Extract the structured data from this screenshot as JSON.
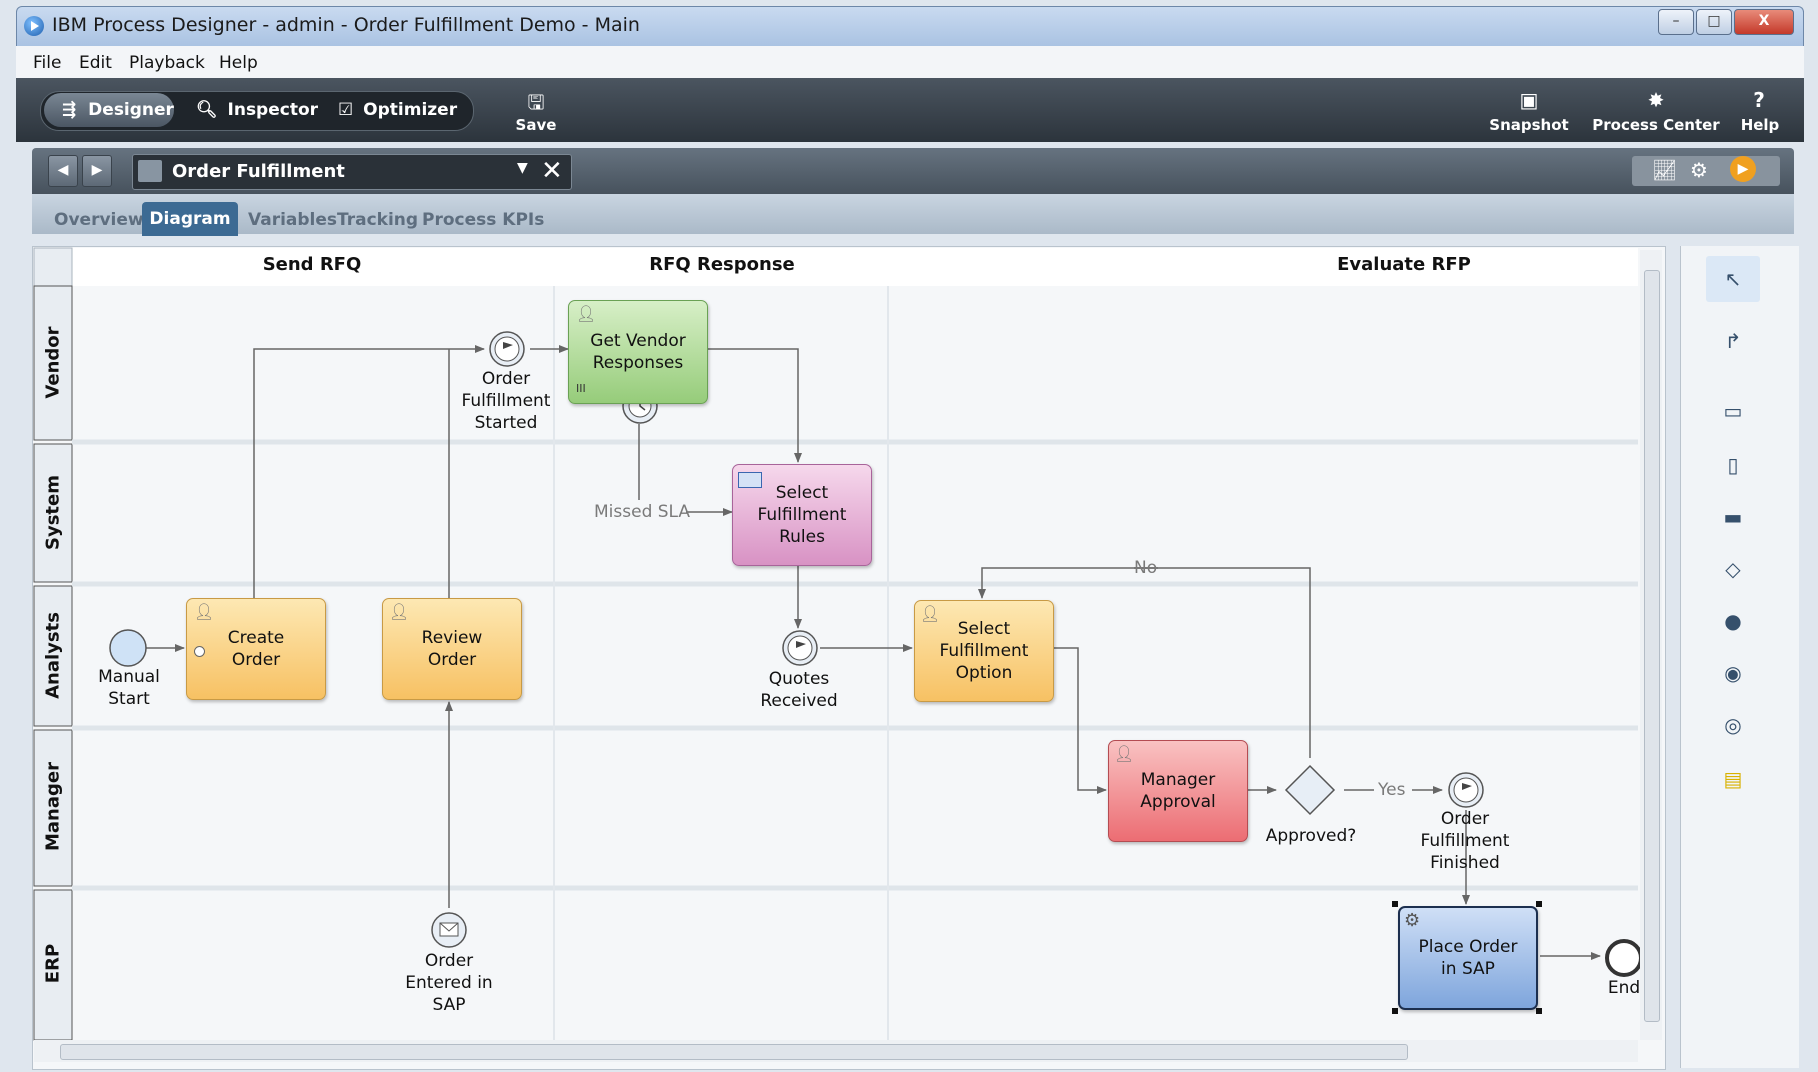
{
  "window": {
    "title": "IBM Process Designer -  admin - Order Fulfillment Demo - Main",
    "controls": {
      "minimize": "–",
      "maximize": "□",
      "close": "X"
    }
  },
  "menu": [
    "File",
    "Edit",
    "Playback",
    "Help"
  ],
  "toolbar": {
    "modes": [
      "Designer",
      "Inspector",
      "Optimizer"
    ],
    "save": "Save",
    "snapshot": "Snapshot",
    "process_center": "Process Center",
    "help": "Help"
  },
  "docbar": {
    "breadcrumb": "Order Fulfillment",
    "close": "✕"
  },
  "tabs": [
    "Overview",
    "Diagram",
    "Variables",
    "Tracking",
    "Process KPIs"
  ],
  "diagram": {
    "phases": [
      "Send RFQ",
      "RFQ Response",
      "Evaluate RFP"
    ],
    "lanes": [
      "Vendor",
      "System",
      "Analysts",
      "Manager",
      "ERP"
    ],
    "activities": {
      "create_order": "Create\nOrder",
      "review_order": "Review\nOrder",
      "get_vendor_responses": "Get Vendor\nResponses",
      "select_fulfillment_rules": "Select\nFulfillment\nRules",
      "select_fulfillment_option": "Select\nFulfillment\nOption",
      "manager_approval": "Manager\nApproval",
      "place_order_in_sap": "Place Order\nin SAP"
    },
    "events": {
      "manual_start": "Manual\nStart",
      "order_fulfillment_started": "Order\nFulfillment\nStarted",
      "quotes_received": "Quotes\nReceived",
      "order_entered_in_sap": "Order\nEntered in\nSAP",
      "order_fulfillment_finished": "Order\nFulfillment\nFinished",
      "end": "End"
    },
    "gateway": "Approved?",
    "flow_labels": {
      "missed_sla": "Missed SLA",
      "no": "No",
      "yes": "Yes"
    }
  },
  "colors": {
    "task_yellow": "#f7c163",
    "task_green": "#96cc7a",
    "task_pink": "#d892c4",
    "task_red": "#ec6d73",
    "task_blue": "#7ea5dc",
    "toolbar": "#2c343c"
  }
}
